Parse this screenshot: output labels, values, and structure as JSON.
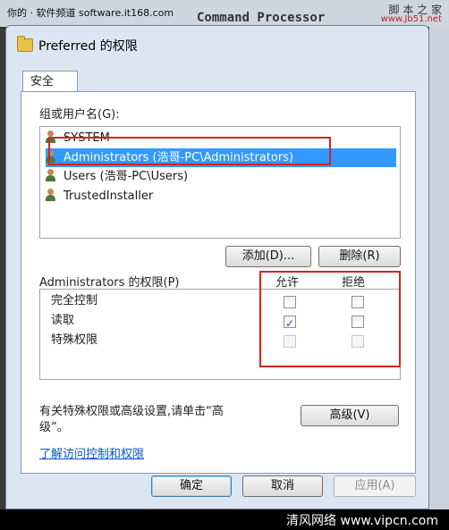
{
  "background": {
    "watermark_left": "你的 · 软件频道 software.it168.com",
    "bg_title": "Command Processor",
    "watermark_right_top": "脚 本 之 家",
    "watermark_right_url": "www.Jb51.net"
  },
  "window": {
    "title": "Preferred 的权限"
  },
  "tabs": [
    {
      "label": "安全"
    }
  ],
  "groups": {
    "label": "组或用户名(G):",
    "users": [
      {
        "name": "SYSTEM",
        "selected": false
      },
      {
        "name": "Administrators (浩哥-PC\\Administrators)",
        "selected": true
      },
      {
        "name": "Users (浩哥-PC\\Users)",
        "selected": false
      },
      {
        "name": "TrustedInstaller",
        "selected": false
      }
    ],
    "add_button": "添加(D)...",
    "remove_button": "删除(R)"
  },
  "permissions": {
    "label": "Administrators 的权限(P)",
    "allow_header": "允许",
    "deny_header": "拒绝",
    "rows": [
      {
        "name": "完全控制",
        "allow": false,
        "deny": false,
        "enabled": true
      },
      {
        "name": "读取",
        "allow": true,
        "deny": false,
        "enabled": true
      },
      {
        "name": "特殊权限",
        "allow": false,
        "deny": false,
        "enabled": false
      }
    ]
  },
  "advanced": {
    "text_line1": "有关特殊权限或高级设置,请单击“高",
    "text_line2": "级”。",
    "button": "高级(V)"
  },
  "link": "了解访问控制和权限",
  "buttons": {
    "ok": "确定",
    "cancel": "取消",
    "apply": "应用(A)"
  },
  "footer": {
    "watermark": "清风网络 www.vipcn.com"
  },
  "colors": {
    "selection": "#3399ff",
    "annotation_red": "#d12424",
    "link": "#0a55c8"
  }
}
